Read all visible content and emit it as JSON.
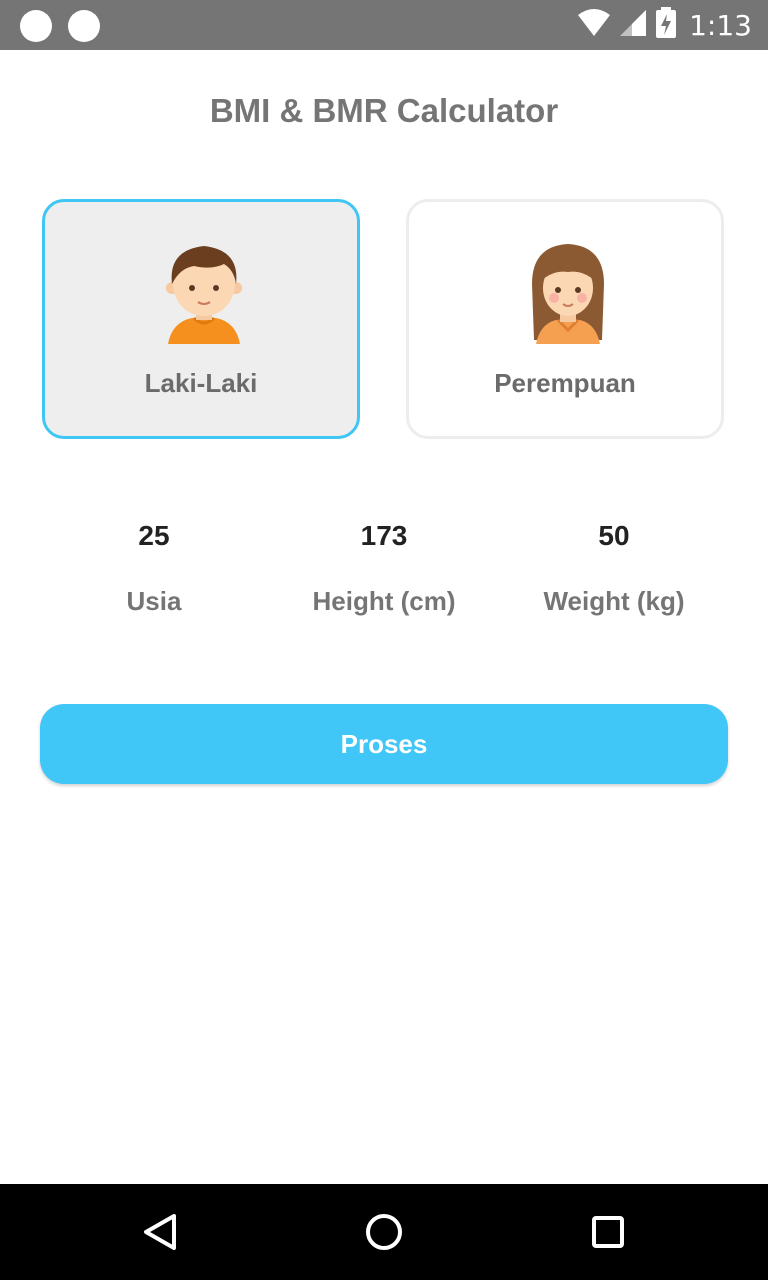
{
  "status_bar": {
    "time": "1:13",
    "icons": [
      "notification-dot-icon",
      "notification-dot-icon",
      "wifi-icon",
      "signal-icon",
      "battery-charging-icon"
    ]
  },
  "app": {
    "title": "BMI & BMR Calculator"
  },
  "gender": {
    "selected": "male",
    "options": [
      {
        "id": "male",
        "label": "Laki-Laki",
        "icon": "boy-avatar-icon"
      },
      {
        "id": "female",
        "label": "Perempuan",
        "icon": "girl-avatar-icon"
      }
    ]
  },
  "stats": {
    "age": {
      "value": "25",
      "label": "Usia"
    },
    "height": {
      "value": "173",
      "label": "Height (cm)"
    },
    "weight": {
      "value": "50",
      "label": "Weight (kg)"
    }
  },
  "actions": {
    "process_label": "Proses"
  },
  "nav": {
    "icons": [
      "back-icon",
      "home-icon",
      "recents-icon"
    ]
  },
  "colors": {
    "accent": "#40c6f7",
    "status_bar": "#757575",
    "text_gray": "#757575",
    "selected_card_bg": "#eeeeee"
  }
}
